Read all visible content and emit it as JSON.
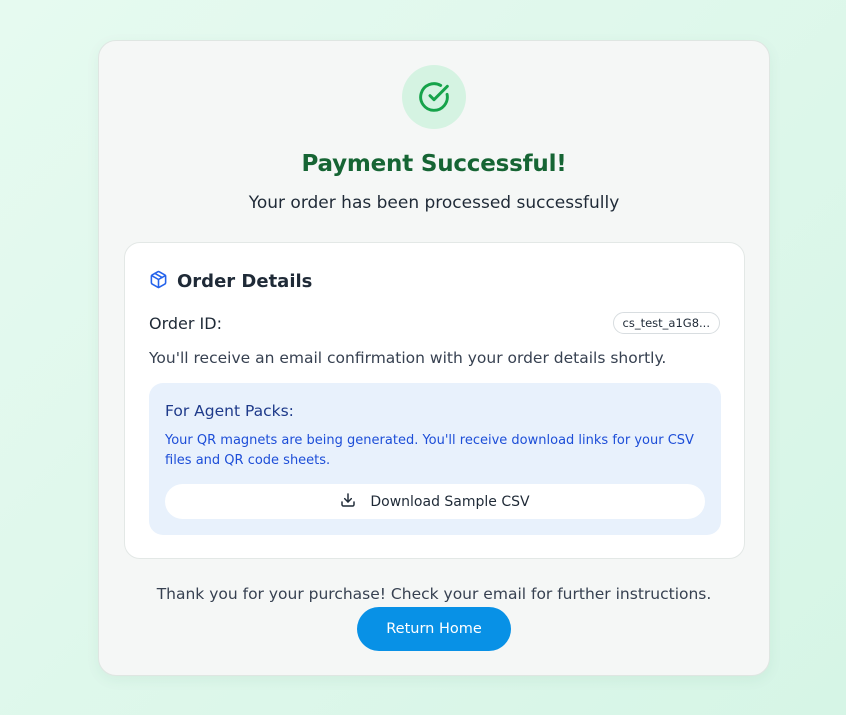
{
  "status": {
    "icon": "check-circle-icon",
    "title": "Payment Successful!",
    "subtitle": "Your order has been processed successfully"
  },
  "order_details": {
    "icon": "package-icon",
    "title": "Order Details",
    "order_id_label": "Order ID:",
    "order_id_value": "cs_test_a1G8...",
    "email_note": "You'll receive an email confirmation with your order details shortly."
  },
  "agent_packs": {
    "title": "For Agent Packs:",
    "text": "Your QR magnets are being generated. You'll receive download links for your CSV files and QR code sheets.",
    "download_icon": "download-icon",
    "download_label": "Download Sample CSV"
  },
  "footer": {
    "thanks": "Thank you for your purchase! Check your email for further instructions.",
    "return_home_label": "Return Home"
  },
  "colors": {
    "success": "#166534",
    "success_bg": "#d5f3e2",
    "accent": "#0891e6",
    "info_bg": "#e8f1fc",
    "info_text": "#1d4ed8"
  }
}
